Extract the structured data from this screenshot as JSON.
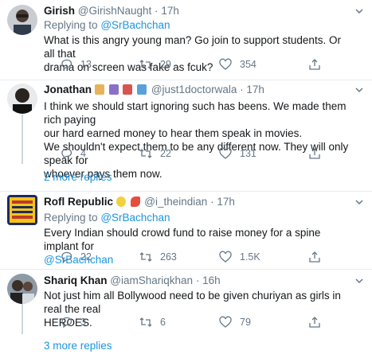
{
  "tweets": [
    {
      "name": "Girish",
      "handle": "@GirishNaught",
      "time": "17h",
      "replying_prefix": "Replying to",
      "replying_handle": "@SrBachchan",
      "text_lines": [
        "What is this angry young man? Go join to support students. Or all that",
        "drama on screen was fake as fcuk?"
      ],
      "replies": "13",
      "retweets": "29",
      "likes": "354"
    },
    {
      "name": "Jonathan",
      "handle": "@just1doctorwala",
      "time": "17h",
      "text_lines": [
        "I think we should start ignoring such has beens. We made them rich paying",
        "our hard earned money to hear them speak in movies.",
        "We shouldn't expect them to be any different now. They will only speak for",
        "whoever pays them now."
      ],
      "replies": "4",
      "retweets": "22",
      "likes": "131",
      "more_replies": "2 more replies"
    },
    {
      "name": "Rofl Republic",
      "handle": "@i_theindian",
      "time": "17h",
      "replying_prefix": "Replying to",
      "replying_handle": "@SrBachchan",
      "text_lines": [
        "Every Indian should crowd fund to raise money for a spine implant for"
      ],
      "mention_line": "@SrBachchan",
      "replies": "22",
      "retweets": "263",
      "likes": "1.5K"
    },
    {
      "name": "Shariq Khan",
      "handle": "@iamShariqkhan",
      "time": "16h",
      "text_lines": [
        "Not just him all Bollywood need to be given churiyan as girls in real the real",
        "HEROES."
      ],
      "replies": "3",
      "retweets": "6",
      "likes": "79",
      "more_replies": "3 more replies"
    }
  ],
  "separator": "·",
  "colors": {
    "accent": "#1b95e0",
    "muted": "#657786",
    "text": "#14171a",
    "border": "#e6ecf0"
  },
  "icons": [
    "reply-icon",
    "retweet-icon",
    "like-icon",
    "share-icon",
    "chevron-down-icon"
  ]
}
